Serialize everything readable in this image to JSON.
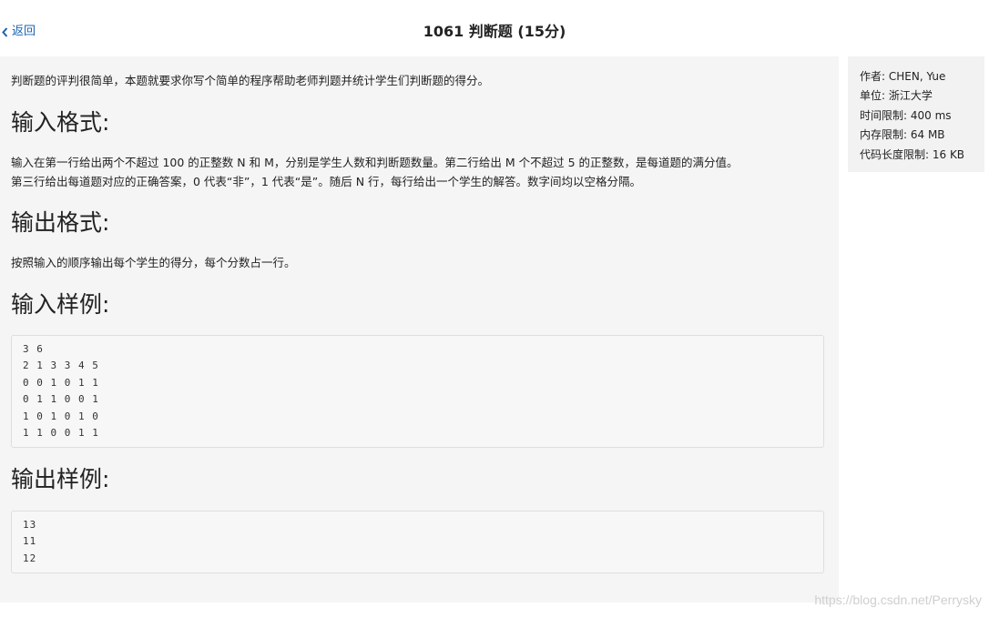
{
  "header": {
    "back_label": "返回",
    "title": "1061 判断题 (15分)"
  },
  "problem": {
    "intro": "判断题的评判很简单，本题就要求你写个简单的程序帮助老师判题并统计学生们判断题的得分。",
    "input_format_heading": "输入格式:",
    "input_format_line1": "输入在第一行给出两个不超过 100 的正整数 N 和 M，分别是学生人数和判断题数量。第二行给出 M 个不超过 5 的正整数，是每道题的满分值。",
    "input_format_line2": "第三行给出每道题对应的正确答案，0 代表“非”，1 代表“是”。随后 N 行，每行给出一个学生的解答。数字间均以空格分隔。",
    "output_format_heading": "输出格式:",
    "output_format_text": "按照输入的顺序输出每个学生的得分，每个分数占一行。",
    "sample_input_heading": "输入样例:",
    "sample_input_lines": [
      "3 6",
      "2 1 3 3 4 5",
      "0 0 1 0 1 1",
      "0 1 1 0 0 1",
      "1 0 1 0 1 0",
      "1 1 0 0 1 1"
    ],
    "sample_output_heading": "输出样例:",
    "sample_output_lines": [
      "13",
      "11",
      "12"
    ]
  },
  "sidebar": {
    "author": "作者: CHEN, Yue",
    "unit": "单位: 浙江大学",
    "time_limit": "时间限制: 400 ms",
    "memory_limit": "内存限制: 64 MB",
    "code_limit": "代码长度限制: 16 KB"
  },
  "watermark": "https://blog.csdn.net/Perrysky",
  "colors": {
    "link": "#1a63b0",
    "content_bg": "#f5f5f5",
    "code_bg": "#f7f7f7"
  }
}
